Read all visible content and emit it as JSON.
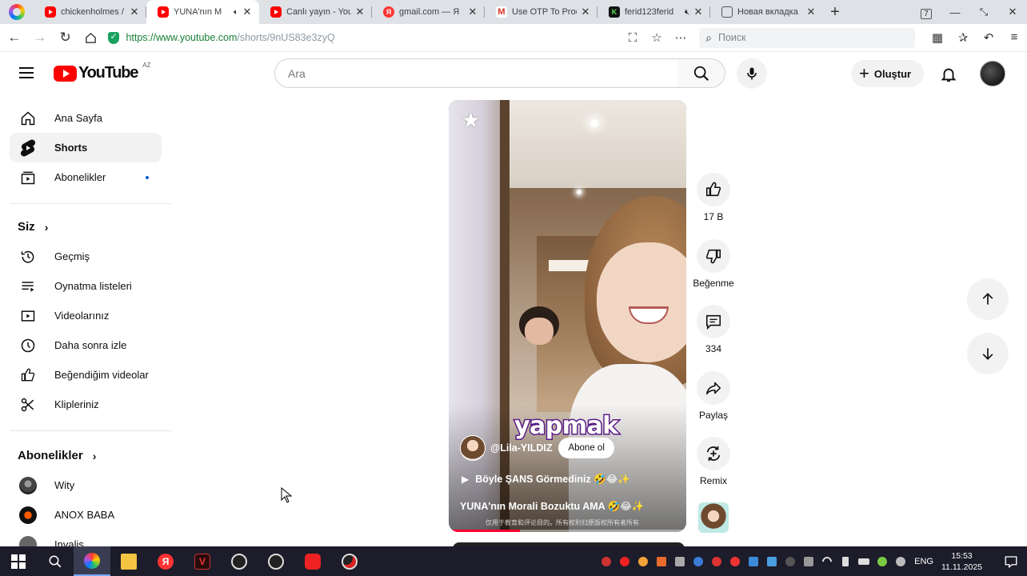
{
  "browser": {
    "tabs": [
      {
        "title": "chickenholmes /",
        "favicon": "youtube-icon",
        "active": false
      },
      {
        "title": "YUNA'nın M",
        "favicon": "youtube-icon",
        "active": true,
        "muted": true
      },
      {
        "title": "Canlı yayın - You",
        "favicon": "youtube-icon",
        "active": false
      },
      {
        "title": "gmail.com — Я",
        "favicon": "yandex-icon",
        "active": false
      },
      {
        "title": "Use OTP To Proc",
        "favicon": "gmail-icon",
        "active": false
      },
      {
        "title": "ferid123ferid",
        "favicon": "kick-icon",
        "active": false,
        "muted": true
      },
      {
        "title": "Новая вкладка",
        "favicon": "newtab-icon",
        "active": false
      }
    ],
    "tab_count_badge": "7",
    "url_scheme": "https://",
    "url_host": "www.youtube.com",
    "url_path": "/shorts/9nUS83e3zyQ",
    "search_placeholder": "Поиск"
  },
  "masthead": {
    "logo_text": "YouTube",
    "country_code": "AZ",
    "search_placeholder": "Ara",
    "create_label": "Oluştur"
  },
  "sidebar": {
    "main": [
      {
        "label": "Ana Sayfa",
        "icon": "home-icon"
      },
      {
        "label": "Shorts",
        "icon": "shorts-icon",
        "active": true
      },
      {
        "label": "Abonelikler",
        "icon": "subscriptions-icon",
        "has_dot": true
      }
    ],
    "you_header": "Siz",
    "you": [
      {
        "label": "Geçmiş",
        "icon": "history-icon"
      },
      {
        "label": "Oynatma listeleri",
        "icon": "playlists-icon"
      },
      {
        "label": "Videolarınız",
        "icon": "your-videos-icon"
      },
      {
        "label": "Daha sonra izle",
        "icon": "watch-later-icon"
      },
      {
        "label": "Beğendiğim videolar",
        "icon": "liked-videos-icon"
      },
      {
        "label": "Klipleriniz",
        "icon": "clips-icon"
      }
    ],
    "subs_header": "Abonelikler",
    "subscriptions": [
      {
        "label": "Wity"
      },
      {
        "label": "ANOX BABA"
      },
      {
        "label": "Invalis"
      }
    ]
  },
  "short": {
    "overlay_word": "yapmak",
    "channel_handle": "@Lila-YILDIZ",
    "subscribe_label": "Abone ol",
    "playlist_title": "Böyle ŞANS Görmediniz 🤣😂✨",
    "title": "YUNA'nın Morali Bozuktu AMA 🤣😂✨",
    "subtitle_text": "仅用于教育和评论目的。所有权利归原版权所有者所有",
    "progress": 0.3
  },
  "actions": {
    "like_count": "17 B",
    "dislike_label": "Beğenme",
    "comment_count": "334",
    "share_label": "Paylaş",
    "remix_label": "Remix"
  },
  "taskbar": {
    "language": "ENG",
    "time": "15:53",
    "date": "11.11.2025"
  },
  "colors": {
    "youtube_red": "#ff0000",
    "active_bg": "#f2f2f2",
    "taskbar_bg": "#1c1c2a",
    "caption_stroke": "#5a1c86"
  }
}
